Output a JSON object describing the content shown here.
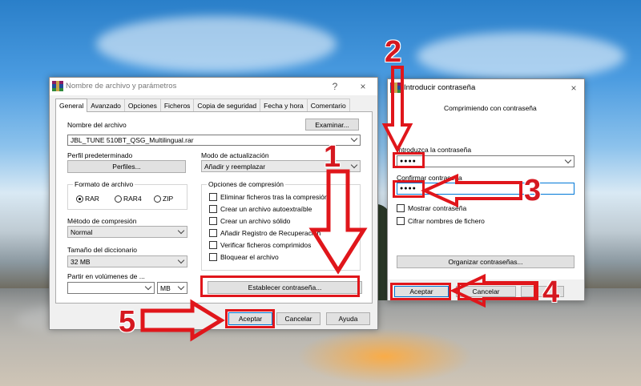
{
  "main_dialog": {
    "title": "Nombre de archivo y parámetros",
    "help_label": "?",
    "close_label": "×",
    "tabs": [
      "General",
      "Avanzado",
      "Opciones",
      "Ficheros",
      "Copia de seguridad",
      "Fecha y hora",
      "Comentario"
    ],
    "archive_name_label": "Nombre del archivo",
    "archive_name_value": "JBL_TUNE 510BT_QSG_Multilingual.rar",
    "browse_button": "Examinar...",
    "default_profile_label": "Perfil predeterminado",
    "profiles_button": "Perfiles...",
    "update_mode_label": "Modo de actualización",
    "update_mode_value": "Añadir y reemplazar",
    "archive_format_label": "Formato de archivo",
    "formats": [
      "RAR",
      "RAR4",
      "ZIP"
    ],
    "selected_format": "RAR",
    "compression_options_label": "Opciones de compresión",
    "compression_options": [
      "Eliminar ficheros tras la compresión",
      "Crear un archivo autoextraíble",
      "Crear un archivo sólido",
      "Añadir Registro de Recuperación",
      "Verificar ficheros comprimidos",
      "Bloquear el archivo"
    ],
    "compression_method_label": "Método de compresión",
    "compression_method_value": "Normal",
    "dictionary_size_label": "Tamaño del diccionario",
    "dictionary_size_value": "32 MB",
    "split_volumes_label": "Partir en volúmenes de ...",
    "split_unit_value": "MB",
    "set_password_button": "Establecer contraseña...",
    "ok_button": "Aceptar",
    "cancel_button": "Cancelar",
    "help_button": "Ayuda"
  },
  "password_dialog": {
    "title": "Introducir contraseña",
    "close_label": "×",
    "heading": "Comprimiendo con contraseña",
    "enter_password_label": "Introduzca la contraseña",
    "password_value": "●●●●",
    "confirm_password_label": "Confirmar contraseña",
    "confirm_value": "●●●●",
    "show_password_label": "Mostrar contraseña",
    "encrypt_names_label": "Cifrar nombres de fichero",
    "organize_button": "Organizar contraseñas...",
    "ok_button": "Aceptar",
    "cancel_button": "Cancelar"
  },
  "annotations": {
    "step1": "1",
    "step2": "2",
    "step3": "3",
    "step4": "4",
    "step5": "5",
    "color": "#e0161b"
  }
}
